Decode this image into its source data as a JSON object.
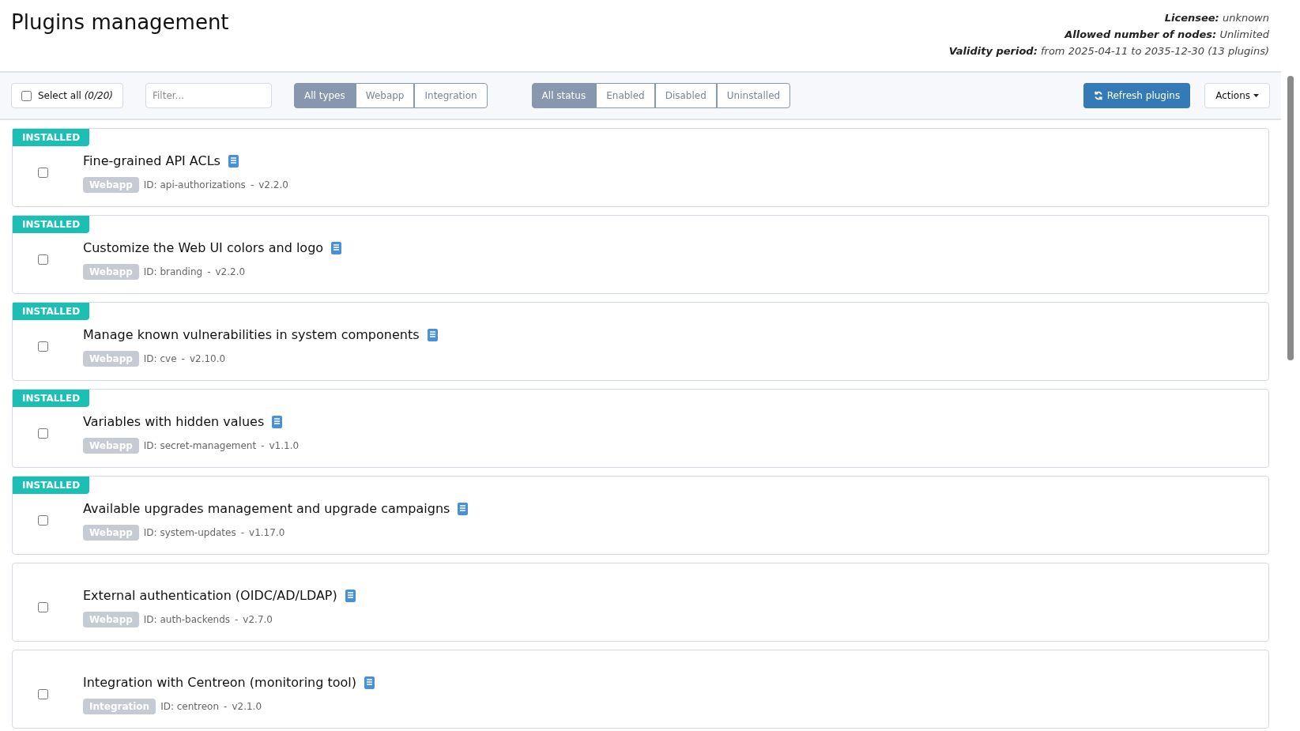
{
  "title": "Plugins management",
  "license": [
    {
      "label": "Licensee:",
      "value": "unknown"
    },
    {
      "label": "Allowed number of nodes:",
      "value": "Unlimited"
    },
    {
      "label": "Validity period:",
      "value": "from 2025-04-11 to 2035-12-30 (13 plugins)"
    }
  ],
  "toolbar": {
    "select_all": {
      "label": "Select all",
      "count": "(0/20)",
      "checked": false
    },
    "filter": {
      "placeholder": "Filter..."
    },
    "type_filters": [
      {
        "label": "All types",
        "selected": true
      },
      {
        "label": "Webapp",
        "selected": false
      },
      {
        "label": "Integration",
        "selected": false
      }
    ],
    "status_filters": [
      {
        "label": "All status",
        "selected": true
      },
      {
        "label": "Enabled",
        "selected": false
      },
      {
        "label": "Disabled",
        "selected": false
      },
      {
        "label": "Uninstalled",
        "selected": false
      }
    ],
    "refresh_button": "Refresh plugins",
    "actions_button": "Actions"
  },
  "plugins": [
    {
      "badge": "INSTALLED",
      "name": "Fine-grained API ACLs",
      "type": "Webapp",
      "id": "ID: api-authorizations",
      "separator": "-",
      "version": "v2.2.0",
      "checked": false
    },
    {
      "badge": "INSTALLED",
      "name": "Customize the Web UI colors and logo",
      "type": "Webapp",
      "id": "ID: branding",
      "separator": "-",
      "version": "v2.2.0",
      "checked": false
    },
    {
      "badge": "INSTALLED",
      "name": "Manage known vulnerabilities in system components",
      "type": "Webapp",
      "id": "ID: cve",
      "separator": "-",
      "version": "v2.10.0",
      "checked": false
    },
    {
      "badge": "INSTALLED",
      "name": "Variables with hidden values",
      "type": "Webapp",
      "id": "ID: secret-management",
      "separator": "-",
      "version": "v1.1.0",
      "checked": false
    },
    {
      "badge": "INSTALLED",
      "name": "Available upgrades management and upgrade campaigns",
      "type": "Webapp",
      "id": "ID: system-updates",
      "separator": "-",
      "version": "v1.17.0",
      "checked": false
    },
    {
      "name": "External authentication (OIDC/AD/LDAP)",
      "type": "Webapp",
      "id": "ID: auth-backends",
      "separator": "-",
      "version": "v2.7.0",
      "checked": false
    },
    {
      "name": "Integration with Centreon (monitoring tool)",
      "type": "Integration",
      "id": "ID: centreon",
      "separator": "-",
      "version": "v2.1.0",
      "checked": false
    }
  ]
}
